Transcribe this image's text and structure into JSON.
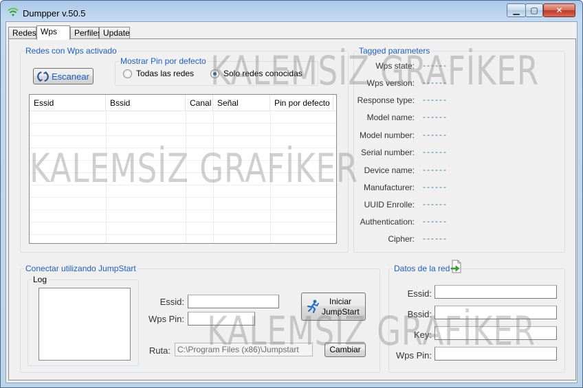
{
  "window": {
    "title": "Dumpper v.50.5",
    "controls": {
      "minimize": "▁",
      "maximize": "▢",
      "close": "✕"
    }
  },
  "tabs": [
    {
      "label": "Redes",
      "active": false
    },
    {
      "label": "Wps",
      "active": true
    },
    {
      "label": "Perfiles",
      "active": false
    },
    {
      "label": "Update",
      "active": false
    }
  ],
  "wps_networks": {
    "group_label": "Redes con Wps activado",
    "scan_button": "Escanear",
    "pin_group_label": "Mostrar Pin por defecto",
    "radio_all": "Todas las redes",
    "radio_known": "Solo redes conocidas",
    "selected_radio": "known",
    "columns": [
      "Essid",
      "Bssid",
      "Canal",
      "Señal",
      "Pin por defecto"
    ],
    "rows": []
  },
  "tagged": {
    "group_label": "Tagged parameters",
    "params": [
      {
        "label": "Wps state:",
        "value": "------"
      },
      {
        "label": "Wps version:",
        "value": "------"
      },
      {
        "label": "Response type:",
        "value": "------"
      },
      {
        "label": "Model name:",
        "value": "------"
      },
      {
        "label": "Model number:",
        "value": "------"
      },
      {
        "label": "Serial number:",
        "value": "------"
      },
      {
        "label": "Device name:",
        "value": "------"
      },
      {
        "label": "Manufacturer:",
        "value": "------"
      },
      {
        "label": "UUID Enrolle:",
        "value": "------"
      },
      {
        "label": "Authentication:",
        "value": "------"
      },
      {
        "label": "Cipher:",
        "value": "------"
      }
    ]
  },
  "jumpstart": {
    "group_label": "Conectar utilizando JumpStart",
    "log_label": "Log",
    "essid_label": "Essid:",
    "essid_value": "",
    "pin_label": "Wps Pin:",
    "pin_value": "",
    "start_button_line1": "Iniciar",
    "start_button_line2": "JumpStart",
    "route_label": "Ruta:",
    "route_value": "C:\\Program Files (x86)\\Jumpstart",
    "change_button": "Cambiar"
  },
  "network_data": {
    "group_label": "Datos de la red",
    "essid_label": "Essid:",
    "essid_value": "",
    "bssid_label": "Bssid:",
    "bssid_value": "",
    "key_label": "Key:",
    "key_value": "",
    "pin_label": "Wps Pin:",
    "pin_value": ""
  },
  "watermark": {
    "text": "KALEMSİZ GRAFİKER"
  },
  "colors": {
    "group_label": "#1e5ebd",
    "param_value": "#2d7f9b",
    "title_bar": "#b9d3ee"
  }
}
